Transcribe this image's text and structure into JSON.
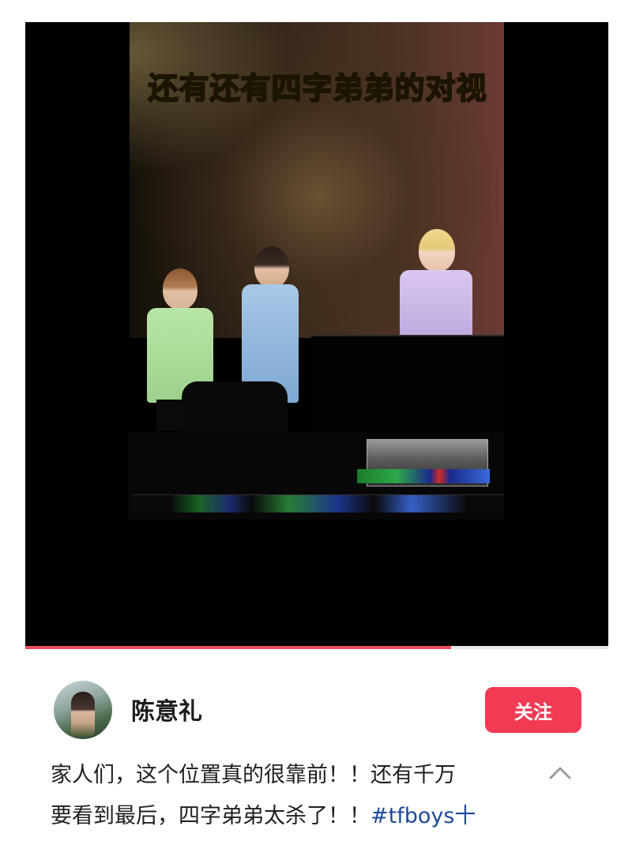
{
  "video": {
    "caption": "还有还有四字弟弟的对视",
    "progress_percent": 73
  },
  "author": {
    "name": "陈意礼",
    "avatar_icon": "avatar-photo"
  },
  "actions": {
    "follow_label": "关注"
  },
  "post": {
    "line1": "家人们，这个位置真的很靠前！！还有千万",
    "line2_text": "要看到最后，四字弟弟太杀了！！",
    "line2_hashtag": "#tfboys十",
    "expand_icon": "chevron-up-icon"
  },
  "colors": {
    "follow_button": "#f23a55",
    "progress": "#ef4d5e",
    "hashtag": "#1e4a9c",
    "caption": "#ffe51a"
  }
}
